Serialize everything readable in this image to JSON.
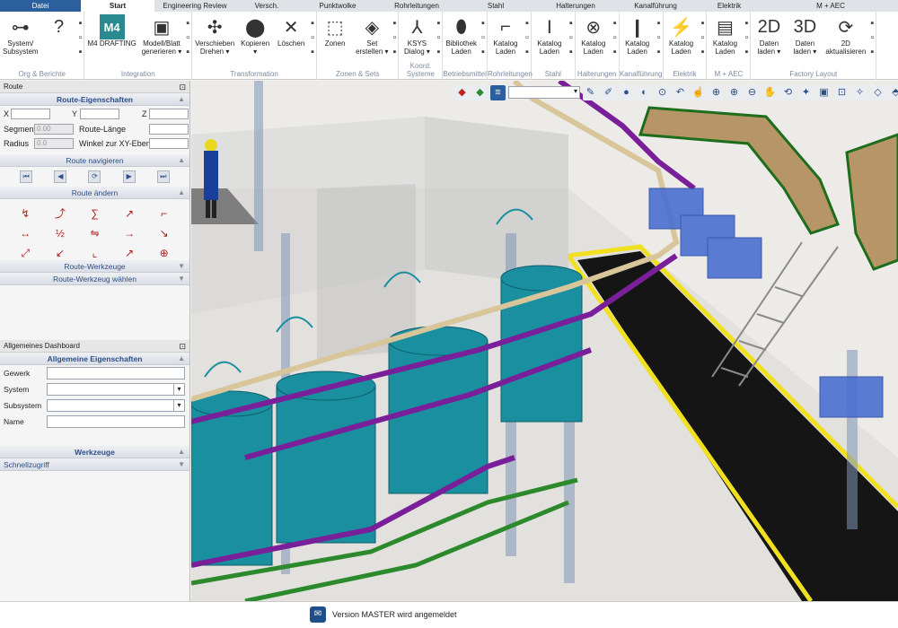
{
  "menu": [
    {
      "label": "Datei",
      "width": 90
    },
    {
      "label": "Start",
      "width": 82
    },
    {
      "label": "Engineering Review",
      "width": 90
    },
    {
      "label": "Versch.",
      "width": 70
    },
    {
      "label": "Punktwolke",
      "width": 88
    },
    {
      "label": "Rohrleitungen",
      "width": 88
    },
    {
      "label": "Stahl",
      "width": 88
    },
    {
      "label": "Halterungen",
      "width": 90
    },
    {
      "label": "Kanalführung",
      "width": 88
    },
    {
      "label": "Elektrik",
      "width": 76
    },
    {
      "label": "M + AEC",
      "width": 150
    }
  ],
  "ribbon_groups": [
    {
      "group": "Org & Berichte",
      "buttons": [
        {
          "label": "System/\nSubsystem",
          "icon": "⊶"
        },
        {
          "label": "",
          "icon": "?"
        }
      ]
    },
    {
      "group": "Integration",
      "buttons": [
        {
          "label": "M4 DRAFTING",
          "icon": "M4"
        },
        {
          "label": "Modell/Blatt\ngenerieren ▾",
          "icon": "▣"
        }
      ]
    },
    {
      "group": "Transformation",
      "buttons": [
        {
          "label": "Verschieben\nDrehen ▾",
          "icon": "✣"
        },
        {
          "label": "Kopieren\n▾",
          "icon": "⬤"
        },
        {
          "label": "Löschen",
          "icon": "✕"
        }
      ]
    },
    {
      "group": "Zonen & Sets",
      "buttons": [
        {
          "label": "Zonen",
          "icon": "⬚"
        },
        {
          "label": "Set\nerstellen ▾",
          "icon": "◈"
        }
      ]
    },
    {
      "group": "Koord. Systeme",
      "buttons": [
        {
          "label": "KSYS\nDialog ▾",
          "icon": "⅄"
        }
      ]
    },
    {
      "group": "Betriebsmittel",
      "buttons": [
        {
          "label": "Bibliothek\nLaden",
          "icon": "⬮"
        }
      ]
    },
    {
      "group": "Rohrleitungen",
      "buttons": [
        {
          "label": "Katalog\nLaden",
          "icon": "⌐"
        }
      ]
    },
    {
      "group": "Stahl",
      "buttons": [
        {
          "label": "Katalog\nLaden",
          "icon": "Ⅰ"
        }
      ]
    },
    {
      "group": "Halterungen",
      "buttons": [
        {
          "label": "Katalog\nLaden",
          "icon": "⊗"
        }
      ]
    },
    {
      "group": "Kanalführung",
      "buttons": [
        {
          "label": "Katalog\nLaden",
          "icon": "❙"
        }
      ]
    },
    {
      "group": "Elektrik",
      "buttons": [
        {
          "label": "Katalog\nLaden",
          "icon": "⚡"
        }
      ]
    },
    {
      "group": "M + AEC",
      "buttons": [
        {
          "label": "Katalog\nLaden",
          "icon": "▤"
        }
      ]
    },
    {
      "group": "Factory Layout",
      "buttons": [
        {
          "label": "Daten\nladen ▾",
          "icon": "2D"
        },
        {
          "label": "Daten\nladen ▾",
          "icon": "3D"
        },
        {
          "label": "2D\naktualisieren",
          "icon": "⟳"
        }
      ]
    }
  ],
  "route_panel": {
    "title": "Route",
    "props_header": "Route-Eigenschaften",
    "x_label": "X",
    "y_label": "Y",
    "z_label": "Z",
    "segment_label": "Segment",
    "segment_value": "0.00",
    "route_length_label": "Route-Länge",
    "radius_label": "Radius",
    "radius_value": "0.0",
    "angle_label": "Winkel zur XY-Ebene",
    "navigate_header": "Route navigieren",
    "change_header": "Route ändern",
    "tools_header": "Route-Werkzeuge",
    "choose_tool_header": "Route-Werkzeug wählen"
  },
  "dashboard": {
    "title": "Allgemeines Dashboard",
    "props_header": "Allgemeine Eigenschaften",
    "fields": [
      {
        "label": "Gewerk",
        "dropdown": false
      },
      {
        "label": "System",
        "dropdown": true
      },
      {
        "label": "Subsystem",
        "dropdown": true
      },
      {
        "label": "Name",
        "dropdown": false
      }
    ],
    "tools_header": "Werkzeuge",
    "quick_access": "Schnellzugriff"
  },
  "status": {
    "message": "Version MASTER wird angemeldet"
  },
  "colors": {
    "accent": "#2c5f9e",
    "pipe_purple": "#7a1f9a",
    "tank": "#1a8fa0",
    "pipe_green": "#2c8a2c",
    "safety_yellow": "#f0e020"
  }
}
